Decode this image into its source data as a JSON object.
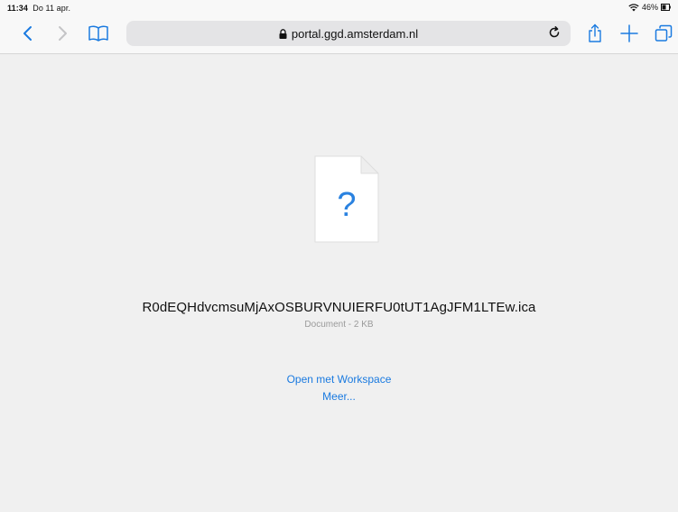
{
  "status_bar": {
    "time": "11:34",
    "date": "Do 11 apr.",
    "battery": "46%"
  },
  "toolbar": {
    "url": "portal.ggd.amsterdam.nl",
    "icons": [
      "back-icon",
      "forward-icon",
      "bookmarks-icon",
      "lock-icon",
      "reload-icon",
      "share-icon",
      "new-tab-icon",
      "tabs-icon"
    ]
  },
  "file": {
    "name": "R0dEQHdvcmsuMjAxOSBURVNUIERFU0tUT1AgJFM1LTEw.ica",
    "meta": "Document - 2 KB",
    "icon_glyph": "?"
  },
  "actions": {
    "open_label": "Open met Workspace",
    "more_label": "Meer..."
  },
  "colors": {
    "accent": "#1a7ae0",
    "background": "#f0f0f0",
    "chrome": "#f8f8f8"
  }
}
